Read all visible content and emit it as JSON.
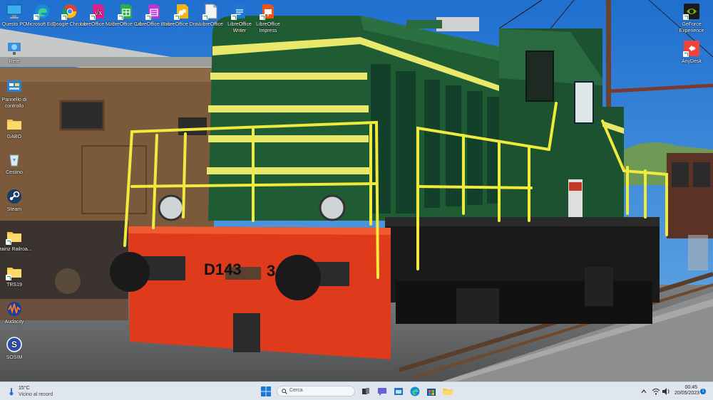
{
  "desktop": {
    "left_icons": [
      {
        "id": "questo-pc",
        "label": "Questo PC",
        "icon": "monitor-icon"
      },
      {
        "id": "rete",
        "label": "Rete",
        "icon": "network-icon"
      },
      {
        "id": "pannello",
        "label": "Pannello di controllo",
        "icon": "control-panel-icon"
      },
      {
        "id": "gabo",
        "label": "GABO",
        "icon": "folder-icon"
      },
      {
        "id": "cestino",
        "label": "Cestino",
        "icon": "recycle-bin-icon"
      },
      {
        "id": "steam",
        "label": "Steam",
        "icon": "steam-icon"
      },
      {
        "id": "trainz",
        "label": "Trainz Railroa...",
        "icon": "folder-icon"
      },
      {
        "id": "trs19",
        "label": "TRS19",
        "icon": "folder-icon"
      },
      {
        "id": "audacity",
        "label": "Audacity",
        "icon": "audacity-icon"
      },
      {
        "id": "sosim",
        "label": "SOSIM",
        "icon": "app-s-icon"
      }
    ],
    "top_icons": [
      {
        "id": "edge",
        "label": "Microsoft Edge",
        "icon": "edge-icon"
      },
      {
        "id": "chrome",
        "label": "Google Chrome",
        "icon": "chrome-icon"
      },
      {
        "id": "math",
        "label": "LibreOffice Math",
        "icon": "libreoffice-math-icon"
      },
      {
        "id": "calc",
        "label": "LibreOffice Calc",
        "icon": "libreoffice-calc-icon"
      },
      {
        "id": "base",
        "label": "LibreOffice Base",
        "icon": "libreoffice-base-icon"
      },
      {
        "id": "draw",
        "label": "LibreOffice Draw",
        "icon": "libreoffice-draw-icon"
      },
      {
        "id": "lo",
        "label": "LibreOffice",
        "icon": "libreoffice-icon"
      },
      {
        "id": "writer",
        "label": "LibreOffice Writer",
        "icon": "libreoffice-writer-icon"
      },
      {
        "id": "impress",
        "label": "LibreOffice Impress",
        "icon": "libreoffice-impress-icon"
      }
    ],
    "right_icons": [
      {
        "id": "geforce",
        "label": "GeForce Experience",
        "icon": "nvidia-icon"
      },
      {
        "id": "anydesk",
        "label": "AnyDesk",
        "icon": "anydesk-icon"
      }
    ],
    "wallpaper": {
      "loco_number": "D143",
      "loco_number_right": "3"
    }
  },
  "taskbar": {
    "weather_temp": "15°C",
    "weather_text": "Vicino al record",
    "search_placeholder": "Cerca",
    "apps": [
      "task-view-icon",
      "teams-chat-icon",
      "edge-icon",
      "file-explorer-icon",
      "store-icon",
      "folder-icon"
    ],
    "time": "00:45",
    "date": "20/05/2023",
    "notification_count": "1"
  },
  "colors": {
    "sky": "#2f7fd6",
    "loco_green": "#1f5c34",
    "loco_stripe": "#e8e86a",
    "buffer_red": "#e03a1c",
    "rail_yellow": "#f0ea3c",
    "taskbar": "#dfe6ee"
  }
}
